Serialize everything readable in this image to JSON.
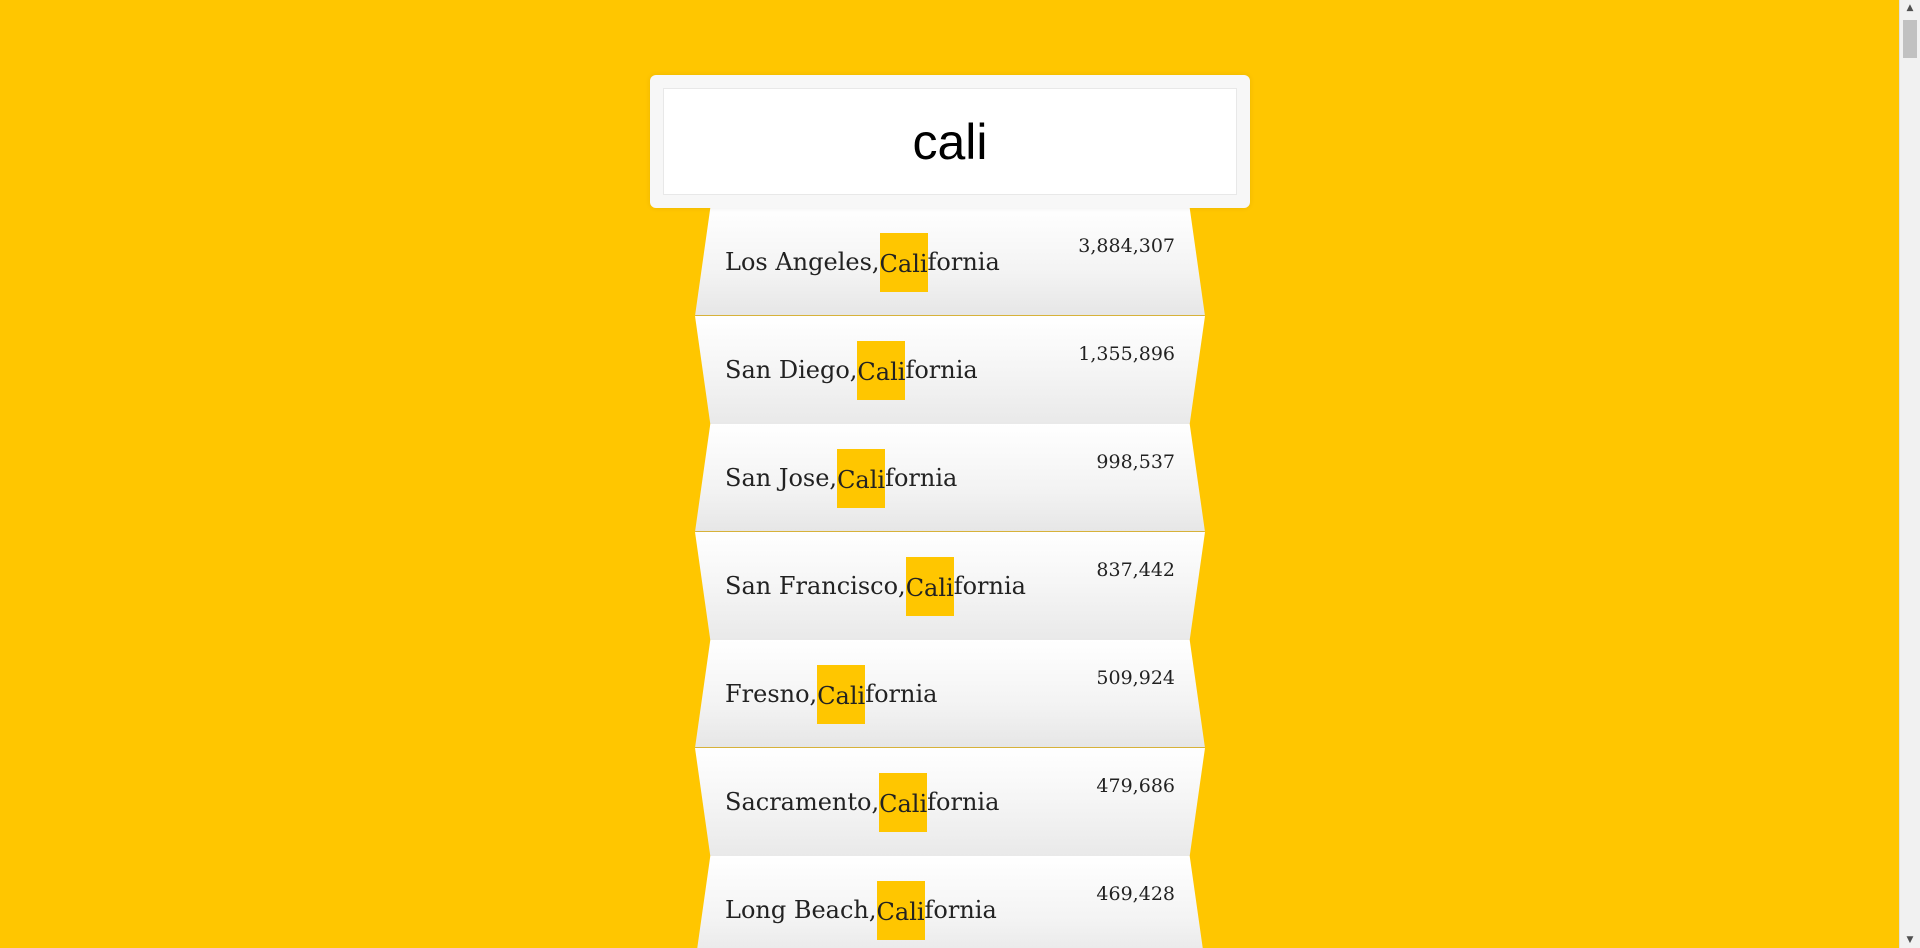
{
  "search": {
    "value": "cali",
    "highlight_color": "#ffc600"
  },
  "suggestions": [
    {
      "prefix": "Los Angeles, ",
      "match": "Cali",
      "suffix": "fornia",
      "population": "3,884,307"
    },
    {
      "prefix": "San Diego, ",
      "match": "Cali",
      "suffix": "fornia",
      "population": "1,355,896"
    },
    {
      "prefix": "San Jose, ",
      "match": "Cali",
      "suffix": "fornia",
      "population": "998,537"
    },
    {
      "prefix": "San Francisco, ",
      "match": "Cali",
      "suffix": "fornia",
      "population": "837,442"
    },
    {
      "prefix": "Fresno, ",
      "match": "Cali",
      "suffix": "fornia",
      "population": "509,924"
    },
    {
      "prefix": "Sacramento, ",
      "match": "Cali",
      "suffix": "fornia",
      "population": "479,686"
    },
    {
      "prefix": "Long Beach, ",
      "match": "Cali",
      "suffix": "fornia",
      "population": "469,428"
    }
  ],
  "scrollbar": {
    "up_icon": "scroll-up-arrow-icon",
    "down_icon": "scroll-down-arrow-icon"
  }
}
